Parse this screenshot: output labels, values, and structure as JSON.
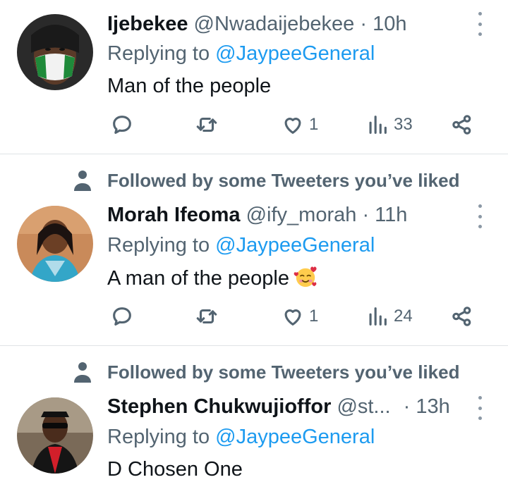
{
  "tweets": [
    {
      "social_context": "",
      "name": "Ijebekee",
      "handle": "@Nwadaijebekee",
      "dot": "·",
      "time": "10h",
      "reply_prefix": "Replying to",
      "reply_to": "@JaypeeGeneral",
      "text": "Man of the people",
      "likes": "1",
      "views": "33"
    },
    {
      "social_context": "Followed by some Tweeters you’ve liked",
      "name": "Morah Ifeoma",
      "handle": "@ify_morah",
      "dot": "·",
      "time": "11h",
      "reply_prefix": "Replying to",
      "reply_to": "@JaypeeGeneral",
      "text": "A man of the people",
      "emoji": "smiling-face-with-hearts",
      "likes": "1",
      "views": "24"
    },
    {
      "social_context": "Followed by some Tweeters you’ve liked",
      "name": "Stephen Chukwujioffor",
      "handle": "@st...",
      "dot": "·",
      "time": "13h",
      "reply_prefix": "Replying to",
      "reply_to": "@JaypeeGeneral",
      "text": "D Chosen One"
    }
  ],
  "colors": {
    "accent": "#1d9bf0",
    "secondary_text": "#536471",
    "primary_text": "#0f1419",
    "divider": "#dfe3e6"
  },
  "icons": [
    "reply-icon",
    "retweet-icon",
    "like-icon",
    "views-icon",
    "share-icon",
    "more-icon",
    "person-icon"
  ]
}
